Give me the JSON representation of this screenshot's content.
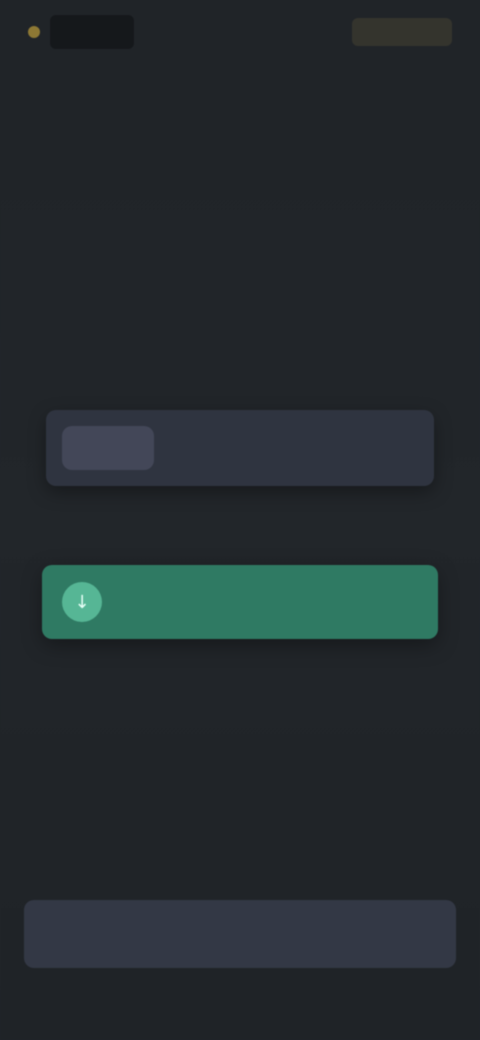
{
  "header": {
    "logo_text": "",
    "action_label": ""
  },
  "hero": {
    "title": "",
    "subtitle": ""
  },
  "pay_card": {
    "chip_label": "",
    "amount": ""
  },
  "divider_mark": "",
  "receive_card": {
    "icon": "arrow-down-icon",
    "label": ""
  },
  "bottom_bar": {
    "label": ""
  },
  "colors": {
    "background": "#22262b",
    "accent_gold": "#c8a63a",
    "pay_card": "#2f3440",
    "receive_card": "#2f7a63",
    "receive_icon": "#56b695",
    "bottom_bar": "#333845"
  }
}
